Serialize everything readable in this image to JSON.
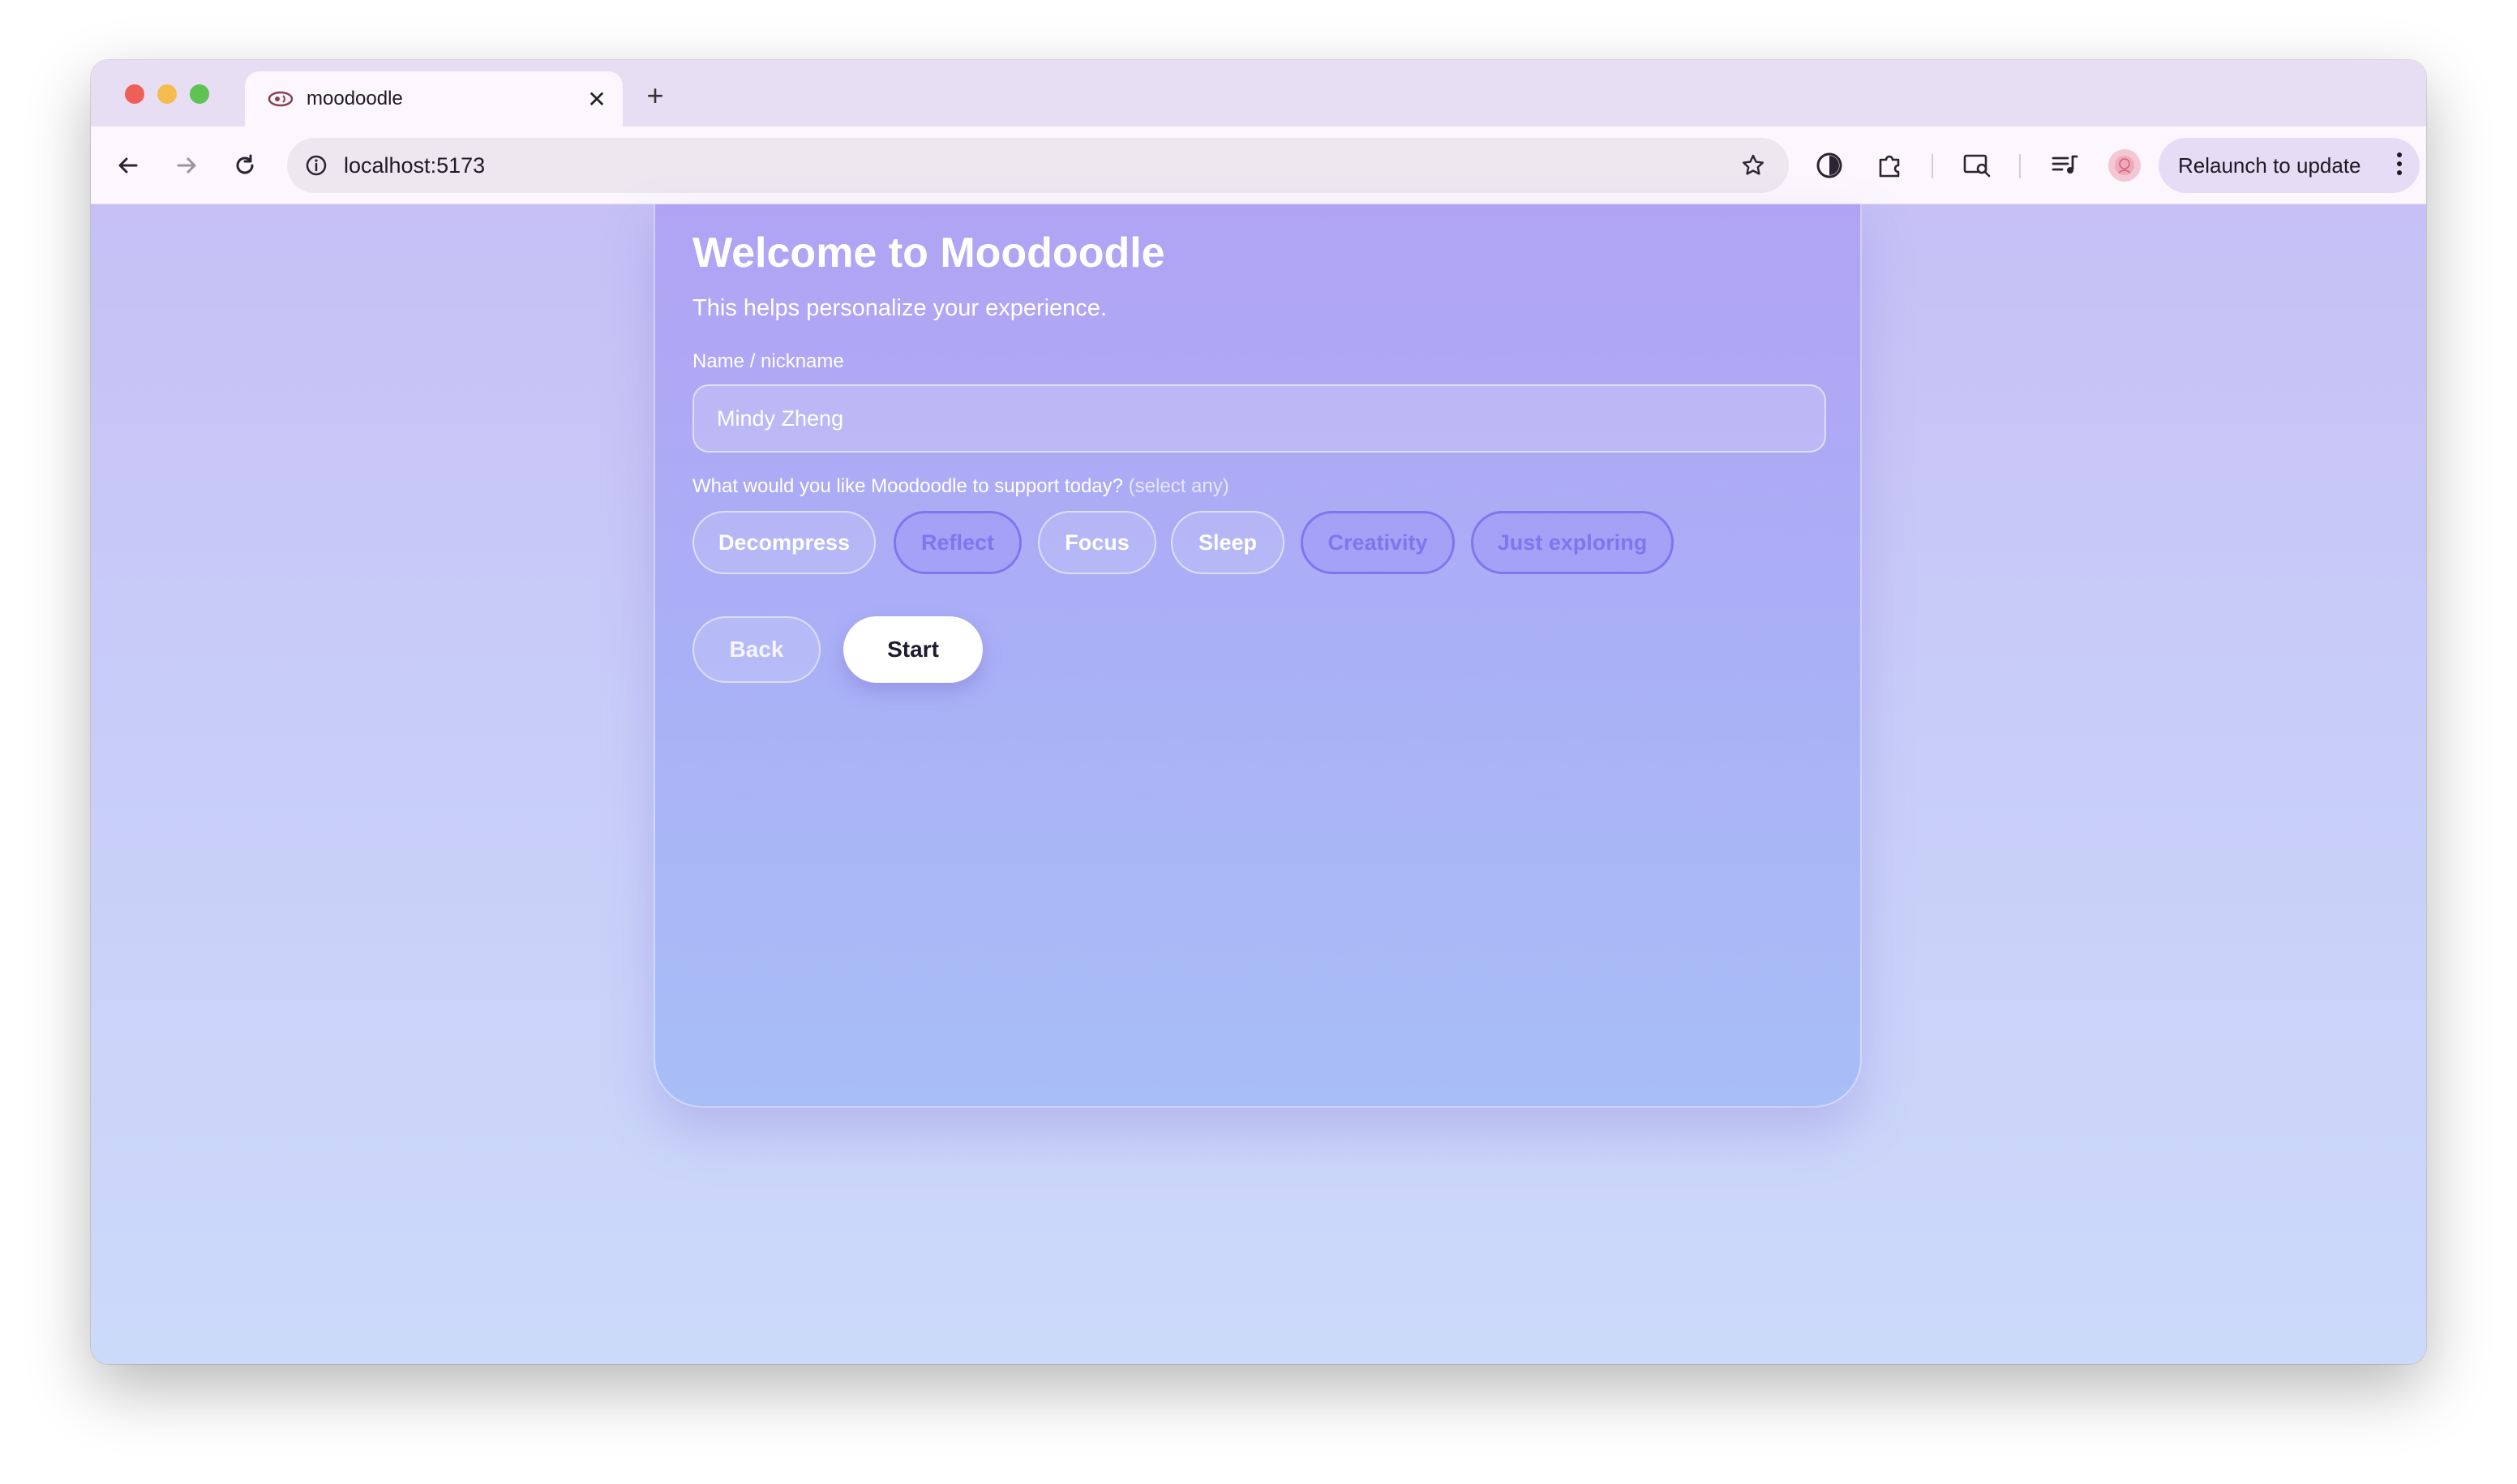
{
  "browser": {
    "tab_title": "moodoodle",
    "tab_close_glyph": "✕",
    "new_tab_glyph": "+",
    "url": "localhost:5173",
    "relaunch_label": "Relaunch to update",
    "icons": [
      "back-arrow-icon",
      "forward-arrow-icon",
      "reload-icon",
      "site-info-icon",
      "bookmark-star-icon",
      "vpn-shield-icon",
      "extensions-puzzle-icon",
      "search-tab-icon",
      "media-controls-icon",
      "profile-avatar-icon",
      "more-menu-icon"
    ]
  },
  "page": {
    "title": "Welcome to Moodoodle",
    "subtitle": "This helps personalize your experience.",
    "name_label": "Name / nickname",
    "name_value": "Mindy Zheng",
    "support_question": "What would you like Moodoodle to support today?",
    "support_hint": "(select any)",
    "options": [
      {
        "label": "Decompress",
        "selected": false
      },
      {
        "label": "Reflect",
        "selected": true
      },
      {
        "label": "Focus",
        "selected": false
      },
      {
        "label": "Sleep",
        "selected": false
      },
      {
        "label": "Creativity",
        "selected": true
      },
      {
        "label": "Just exploring",
        "selected": true
      }
    ],
    "back_label": "Back",
    "start_label": "Start"
  },
  "colors": {
    "accent": "#7f76ee",
    "card_top": "#b1a3f4",
    "card_bottom": "#a8bef7",
    "background": "#c8cdf8",
    "tabstrip": "#e8def4"
  }
}
